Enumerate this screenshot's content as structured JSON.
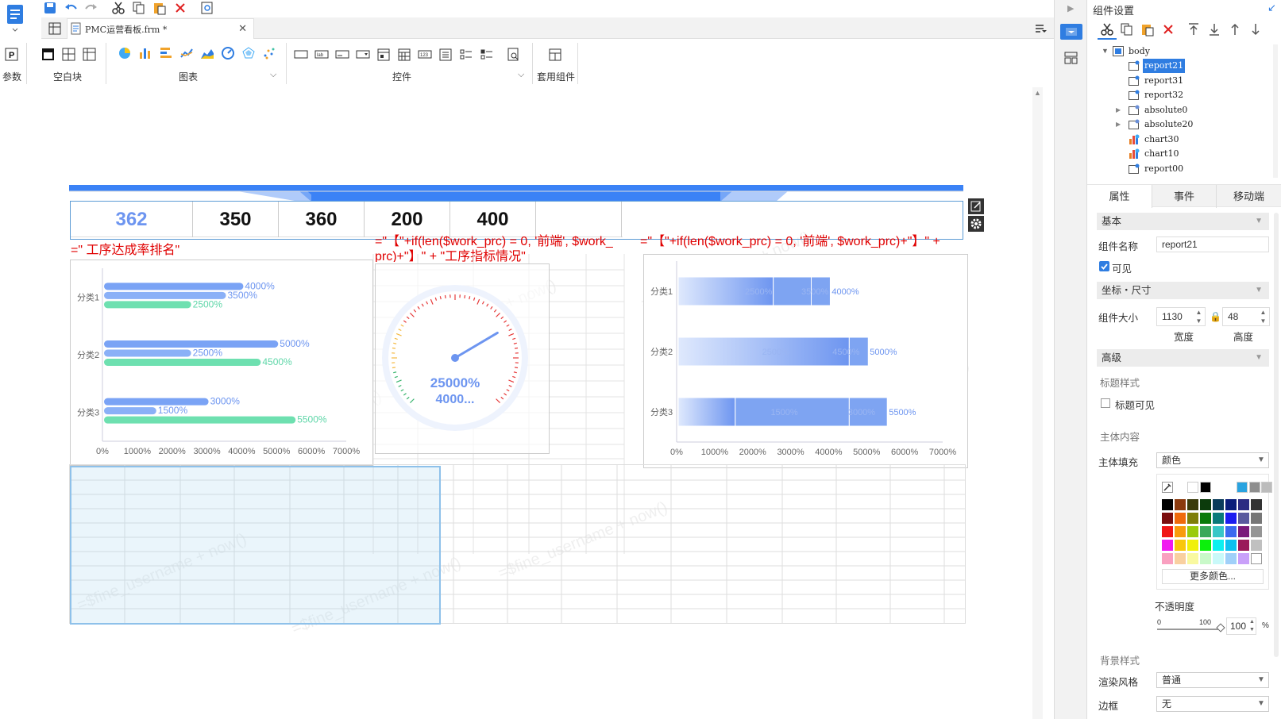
{
  "toolbar": {
    "file_tab": "PMC运营看板.frm *",
    "groups": {
      "param": "参数",
      "blank": "空白块",
      "chart": "图表",
      "control": "控件",
      "template": "套用组件"
    }
  },
  "kpi": {
    "values": [
      "362",
      "350",
      "360",
      "200",
      "400"
    ]
  },
  "formulas": {
    "left": "=\" 工序达成率排名\"",
    "mid": "=\"【\"+if(len($work_prc) = 0, '前端', $work_",
    "mid2": "prc)+\"】\" + \"工序指标情况\"",
    "right": "=\"【\"+if(len($work_prc) = 0, '前端', $work_prc)+\"】\" +"
  },
  "watermark": "=$fine_username + now()",
  "chart_data": [
    {
      "type": "bar",
      "orientation": "horizontal",
      "categories": [
        "分类1",
        "分类2",
        "分类3"
      ],
      "series": [
        {
          "values": [
            4000,
            5000,
            3000
          ],
          "color": "#7aa3f5"
        },
        {
          "values": [
            3500,
            2500,
            1500
          ],
          "color": "#8ab0f7"
        },
        {
          "values": [
            2500,
            4500,
            5500
          ],
          "color": "#6ee0b0"
        }
      ],
      "xlim": [
        0,
        7000
      ],
      "ticks": [
        "0%",
        "1000%",
        "2000%",
        "3000%",
        "4000%",
        "5000%",
        "6000%",
        "7000%"
      ]
    },
    {
      "type": "gauge",
      "value_label": "25000%",
      "sub_label": "4000..."
    },
    {
      "type": "bar",
      "orientation": "horizontal",
      "stacked": true,
      "categories": [
        "分类1",
        "分类2",
        "分类3"
      ],
      "series": [
        {
          "values": [
            2500,
            4500,
            1500
          ]
        },
        {
          "values": [
            1000,
            500,
            3000
          ]
        },
        {
          "values": [
            500,
            0,
            1000
          ]
        }
      ],
      "labels": [
        [
          "2500%",
          "3500%",
          "4000%"
        ],
        [
          "2500%",
          "4500%",
          "5000%"
        ],
        [
          "1500%",
          "3000%",
          "5500%"
        ]
      ],
      "xlim": [
        0,
        7000
      ],
      "ticks": [
        "0%",
        "1000%",
        "2000%",
        "3000%",
        "4000%",
        "5000%",
        "6000%",
        "7000%"
      ]
    }
  ],
  "right_panel": {
    "title": "组件设置",
    "tree": {
      "root": "body",
      "items": [
        "report21",
        "report31",
        "report32",
        "absolute0",
        "absolute20",
        "chart30",
        "chart10",
        "report00"
      ],
      "selected": "report21"
    },
    "tabs": [
      "属性",
      "事件",
      "移动端"
    ],
    "basic": {
      "section": "基本",
      "name_label": "组件名称",
      "name_value": "report21",
      "visible_label": "可见"
    },
    "coords": {
      "section": "坐标・尺寸",
      "size_label": "组件大小",
      "width": "1130",
      "height": "48",
      "width_label": "宽度",
      "height_label": "高度"
    },
    "advanced": {
      "section": "高级",
      "title_style": "标题样式",
      "title_visible": "标题可见",
      "body_content": "主体内容",
      "body_fill": "主体填充",
      "fill_value": "颜色",
      "more_colors": "更多颜色...",
      "opacity_label": "不透明度",
      "opacity_value": "100",
      "slider_min": "0",
      "slider_max": "100",
      "percent": "%",
      "bg_style": "背景样式",
      "render_label": "渲染风格",
      "render_value": "普通",
      "border_label": "边框",
      "border_value": "无"
    }
  }
}
